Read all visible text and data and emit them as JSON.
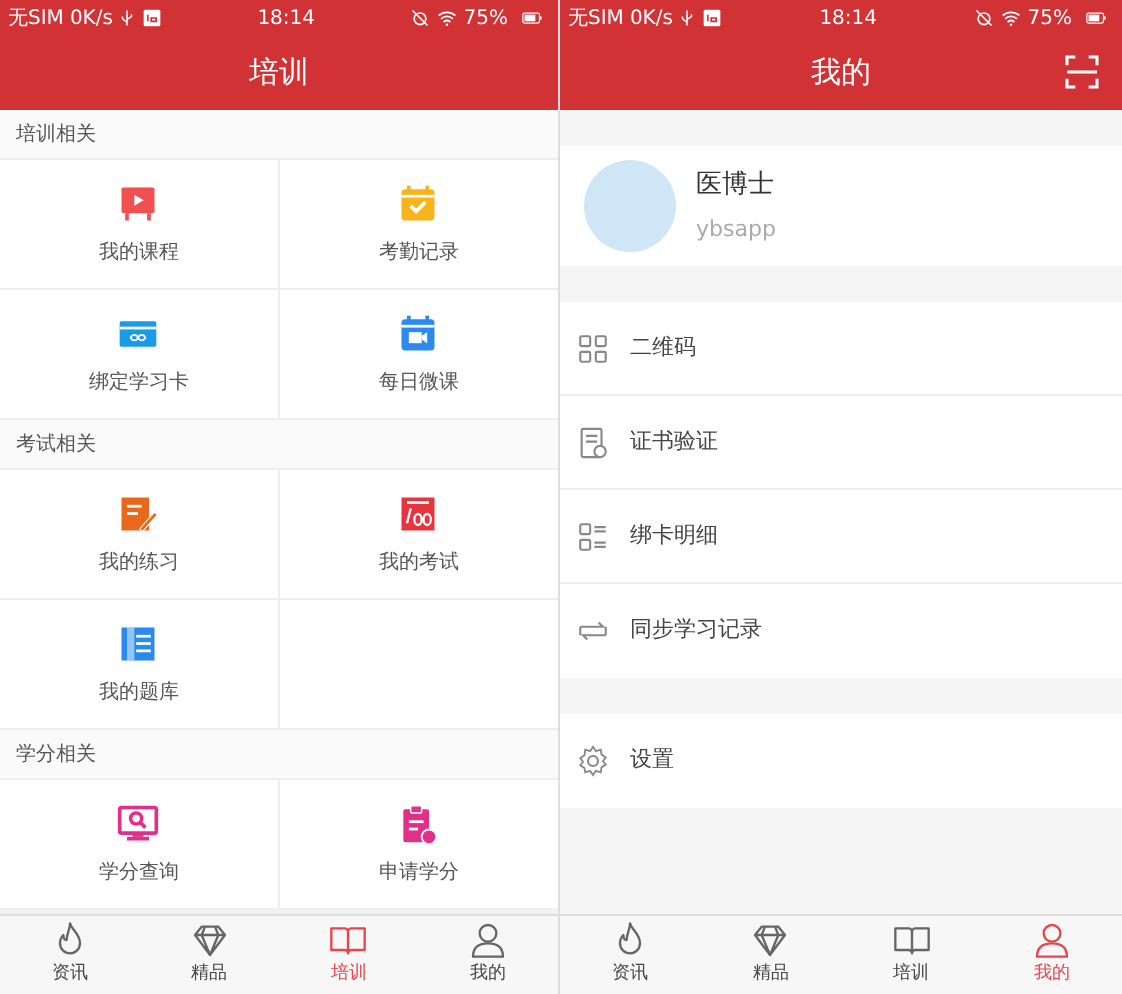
{
  "screens": [
    {
      "status_bar": {
        "carrier": "无SIM",
        "speed": "0K/s",
        "time": "18:14",
        "battery": "75%"
      },
      "header": {
        "title": "培训"
      },
      "sections": [
        {
          "title": "培训相关",
          "items": [
            {
              "kind": "course",
              "label": "我的课程"
            },
            {
              "kind": "attendance",
              "label": "考勤记录"
            },
            {
              "kind": "card",
              "label": "绑定学习卡"
            },
            {
              "kind": "daily",
              "label": "每日微课"
            }
          ]
        },
        {
          "title": "考试相关",
          "items": [
            {
              "kind": "practice",
              "label": "我的练习"
            },
            {
              "kind": "exam",
              "label": "我的考试"
            },
            {
              "kind": "bank",
              "label": "我的题库"
            }
          ]
        },
        {
          "title": "学分相关",
          "items": [
            {
              "kind": "query",
              "label": "学分查询"
            },
            {
              "kind": "apply",
              "label": "申请学分"
            }
          ]
        }
      ],
      "tab_bar": [
        {
          "kind": "news",
          "label": "资讯",
          "selected": false
        },
        {
          "kind": "premium",
          "label": "精品",
          "selected": false
        },
        {
          "kind": "training",
          "label": "培训",
          "selected": true
        },
        {
          "kind": "me",
          "label": "我的",
          "selected": false
        }
      ]
    },
    {
      "status_bar": {
        "carrier": "无SIM",
        "speed": "0K/s",
        "time": "18:14",
        "battery": "75%"
      },
      "header": {
        "title": "我的",
        "actions": [
          {
            "kind": "scan"
          }
        ]
      },
      "profile": {
        "name": "医博士",
        "username": "ybsapp"
      },
      "menu_groups": [
        [
          {
            "kind": "qrcode",
            "label": "二维码"
          },
          {
            "kind": "certificate",
            "label": "证书验证"
          },
          {
            "kind": "cards",
            "label": "绑卡明细"
          },
          {
            "kind": "sync",
            "label": "同步学习记录"
          }
        ],
        [
          {
            "kind": "settings",
            "label": "设置"
          }
        ]
      ],
      "tab_bar": [
        {
          "kind": "news",
          "label": "资讯",
          "selected": false
        },
        {
          "kind": "premium",
          "label": "精品",
          "selected": false
        },
        {
          "kind": "training",
          "label": "培训",
          "selected": false
        },
        {
          "kind": "me",
          "label": "我的",
          "selected": true
        }
      ]
    }
  ]
}
